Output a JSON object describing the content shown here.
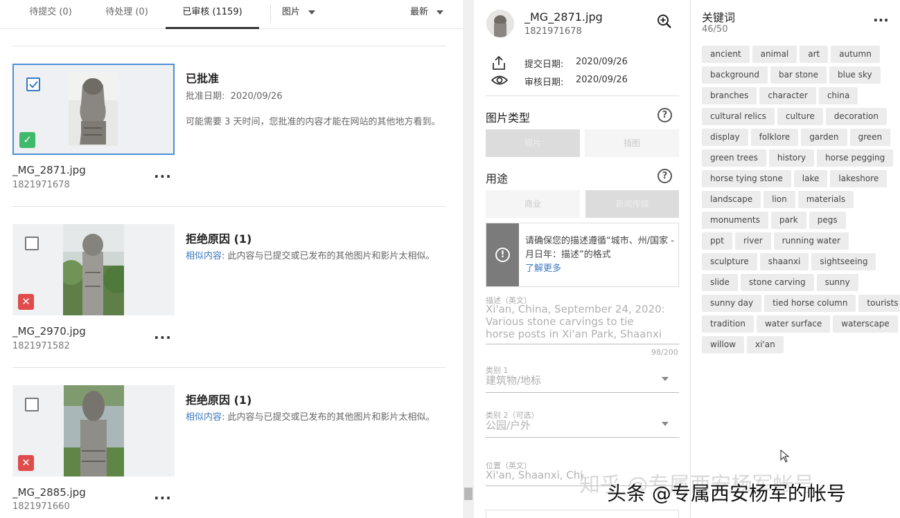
{
  "tabs": [
    {
      "label": "待提交 (0)"
    },
    {
      "label": "待处理 (0)"
    },
    {
      "label": "已审核 (1159)"
    }
  ],
  "filter_type": "图片",
  "sort": "最新",
  "items": [
    {
      "filename": "_MG_2871.jpg",
      "id": "1821971678",
      "status": "approved",
      "title": "已批准",
      "date_label": "批准日期:",
      "date": "2020/09/26",
      "message": "可能需要 3 天时间，您批准的内容才能在网站的其他地方看到。"
    },
    {
      "filename": "_MG_2970.jpg",
      "id": "1821971582",
      "status": "rejected",
      "title": "拒绝原因 (1)",
      "reason_link": "相似内容",
      "reason": ": 此内容与已提交或已发布的其他图片和影片太相似。"
    },
    {
      "filename": "_MG_2885.jpg",
      "id": "1821971660",
      "status": "rejected",
      "title": "拒绝原因 (1)",
      "reason_link": "相似内容",
      "reason": ": 此内容与已提交或已发布的其他图片和影片太相似。"
    }
  ],
  "detail": {
    "filename": "_MG_2871.jpg",
    "id": "1821971678",
    "submit_label": "提交日期:",
    "submit_date": "2020/09/26",
    "review_label": "审核日期:",
    "review_date": "2020/09/26",
    "image_type_title": "图片类型",
    "image_type_options": [
      "照片",
      "插图"
    ],
    "image_type_selected": "照片",
    "usage_title": "用途",
    "usage_options": [
      "商业",
      "新闻传媒"
    ],
    "usage_selected": "新闻传媒",
    "alert_text": "请确保您的描述遵循“城市、州/国家 - 月日年：描述”的格式",
    "alert_link": "了解更多",
    "description_label": "描述（英文）",
    "description_value": "Xi'an, China, September 24, 2020: Various stone carvings to tie horse posts in Xi'an Park, Shaanxi",
    "description_count": "98/200",
    "category1_label": "类别 1",
    "category1_value": "建筑物/地标",
    "category2_label": "类别 2（可选）",
    "category2_value": "公园/户外",
    "location_label": "位置（英文）",
    "location_value": "Xi'an, Shaanxi, Chi"
  },
  "keywords": {
    "title": "关键词",
    "count": "46/50",
    "rows": [
      [
        "ancient",
        "animal",
        "art",
        "autumn"
      ],
      [
        "background",
        "bar stone",
        "blue sky"
      ],
      [
        "branches",
        "character",
        "china"
      ],
      [
        "cultural relics",
        "culture",
        "decoration"
      ],
      [
        "display",
        "folklore",
        "garden",
        "green"
      ],
      [
        "green trees",
        "history",
        "horse pegging"
      ],
      [
        "horse tying stone",
        "lake",
        "lakeshore"
      ],
      [
        "landscape",
        "lion",
        "materials"
      ],
      [
        "monuments",
        "park",
        "pegs"
      ],
      [
        "ppt",
        "river",
        "running water"
      ],
      [
        "sculpture",
        "shaanxi",
        "sightseeing"
      ],
      [
        "slide",
        "stone carving",
        "sunny"
      ],
      [
        "sunny day",
        "tied horse column",
        "tourists"
      ],
      [
        "tradition",
        "water surface",
        "waterscape"
      ],
      [
        "willow",
        "xi'an"
      ]
    ]
  },
  "watermark_faint": "知乎 @专属西安杨军帐号",
  "watermark": "头条 @专属西安杨军的帐号",
  "colors": {
    "accent": "#3a78c2",
    "approved": "#3fb96a",
    "rejected": "#e04b4b"
  }
}
